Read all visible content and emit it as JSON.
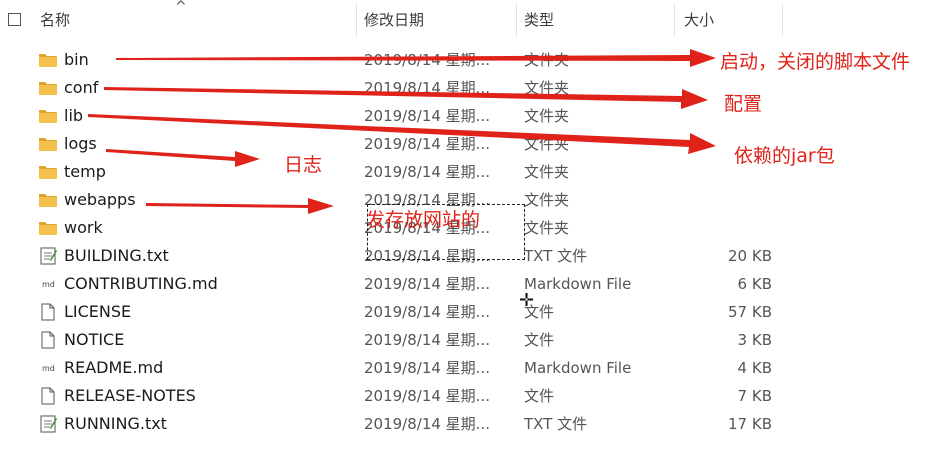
{
  "header": {
    "name_label": "名称",
    "date_label": "修改日期",
    "type_label": "类型",
    "size_label": "大小",
    "sort_arrow": "^"
  },
  "files": [
    {
      "name": "bin",
      "date": "2019/8/14 星期...",
      "type": "文件夹",
      "size": "",
      "icon": "folder-icon"
    },
    {
      "name": "conf",
      "date": "2019/8/14 星期...",
      "type": "文件夹",
      "size": "",
      "icon": "folder-icon"
    },
    {
      "name": "lib",
      "date": "2019/8/14 星期...",
      "type": "文件夹",
      "size": "",
      "icon": "folder-icon"
    },
    {
      "name": "logs",
      "date": "2019/8/14 星期...",
      "type": "文件夹",
      "size": "",
      "icon": "folder-icon"
    },
    {
      "name": "temp",
      "date": "2019/8/14 星期...",
      "type": "文件夹",
      "size": "",
      "icon": "folder-icon"
    },
    {
      "name": "webapps",
      "date": "2019/8/14 星期...",
      "type": "文件夹",
      "size": "",
      "icon": "folder-icon"
    },
    {
      "name": "work",
      "date": "2019/8/14 星期...",
      "type": "文件夹",
      "size": "",
      "icon": "folder-icon"
    },
    {
      "name": "BUILDING.txt",
      "date": "2019/8/14 星期...",
      "type": "TXT 文件",
      "size": "20 KB",
      "icon": "text-file-icon"
    },
    {
      "name": "CONTRIBUTING.md",
      "date": "2019/8/14 星期...",
      "type": "Markdown File",
      "size": "6 KB",
      "icon": "markdown-file-icon"
    },
    {
      "name": "LICENSE",
      "date": "2019/8/14 星期...",
      "type": "文件",
      "size": "57 KB",
      "icon": "blank-file-icon"
    },
    {
      "name": "NOTICE",
      "date": "2019/8/14 星期...",
      "type": "文件",
      "size": "3 KB",
      "icon": "blank-file-icon"
    },
    {
      "name": "README.md",
      "date": "2019/8/14 星期...",
      "type": "Markdown File",
      "size": "4 KB",
      "icon": "markdown-file-icon"
    },
    {
      "name": "RELEASE-NOTES",
      "date": "2019/8/14 星期...",
      "type": "文件",
      "size": "7 KB",
      "icon": "blank-file-icon"
    },
    {
      "name": "RUNNING.txt",
      "date": "2019/8/14 星期...",
      "type": "TXT 文件",
      "size": "17 KB",
      "icon": "text-file-icon"
    }
  ],
  "annotations": {
    "bin": "启动，关闭的脚本文件",
    "conf": "配置",
    "lib": "依赖的jar包",
    "logs": "日志",
    "webapps": "发存放网站的"
  },
  "colors": {
    "annotation": "#e0231a",
    "folder": "#f2c14e",
    "folder_dark": "#dba52c"
  }
}
